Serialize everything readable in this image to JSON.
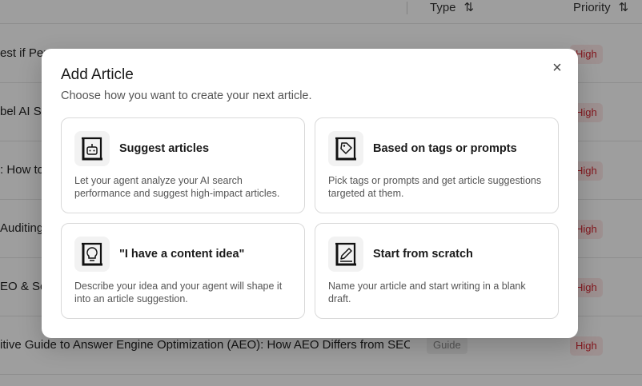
{
  "table": {
    "columns": {
      "type": "Type",
      "priority": "Priority"
    },
    "rows": [
      {
        "title": "est if Per",
        "type": "",
        "priority": "High"
      },
      {
        "title": "bel AI Se",
        "type": "",
        "priority": "High"
      },
      {
        "title": ": How to",
        "type": "",
        "priority": "High"
      },
      {
        "title": "Auditing",
        "type": "",
        "priority": "High"
      },
      {
        "title": "EO & Sea",
        "type": "",
        "priority": "High"
      },
      {
        "title": "itive Guide to Answer Engine Optimization (AEO): How AEO Differs from SEO a...",
        "type": "Guide",
        "priority": "High"
      }
    ]
  },
  "modal": {
    "title": "Add Article",
    "subtitle": "Choose how you want to create your next article.",
    "close_icon": "×",
    "cards": [
      {
        "icon": "robot-icon",
        "title": "Suggest articles",
        "description": "Let your agent analyze your AI search performance and suggest high-impact articles."
      },
      {
        "icon": "tag-icon",
        "title": "Based on tags or prompts",
        "description": "Pick tags or prompts and get article suggestions targeted at them."
      },
      {
        "icon": "lightbulb-icon",
        "title": "\"I have a content idea\"",
        "description": "Describe your idea and your agent will shape it into an article suggestion."
      },
      {
        "icon": "pencil-icon",
        "title": "Start from scratch",
        "description": "Name your article and start writing in a blank draft."
      }
    ]
  }
}
